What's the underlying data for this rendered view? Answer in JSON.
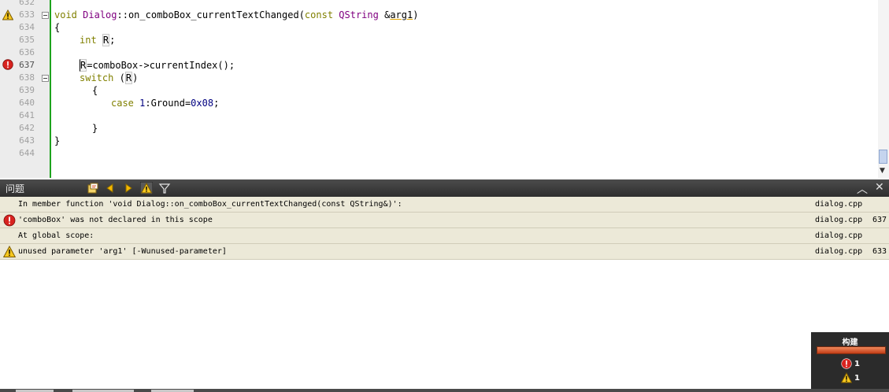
{
  "editor": {
    "lines": [
      {
        "num": "632",
        "text": ""
      },
      {
        "num": "633",
        "text": "void Dialog::on_comboBox_currentTextChanged(const QString &arg1)"
      },
      {
        "num": "634",
        "text": "{"
      },
      {
        "num": "635",
        "text": "int R;"
      },
      {
        "num": "636",
        "text": ""
      },
      {
        "num": "637",
        "text": "R=comboBox->currentIndex();"
      },
      {
        "num": "638",
        "text": "switch (R)"
      },
      {
        "num": "639",
        "text": "{"
      },
      {
        "num": "640",
        "text": "case 1:Ground=0x08;"
      },
      {
        "num": "641",
        "text": ""
      },
      {
        "num": "642",
        "text": "}"
      },
      {
        "num": "643",
        "text": "}"
      },
      {
        "num": "644",
        "text": ""
      }
    ],
    "tokens": {
      "kw_void": "void",
      "cls_dialog": "Dialog",
      "fn_sig": "::on_comboBox_currentTextChanged(",
      "kw_const": "const",
      "cls_qstring": "QString",
      "amp": " &",
      "arg1": "arg1",
      "close_paren": ")",
      "brace_open": "{",
      "kw_int": "int",
      "var_r": "R",
      "semi": ";",
      "stmt_637_rest": "=comboBox->currentIndex();",
      "kw_switch": "switch",
      "paren_open": "(",
      "paren_close": ")",
      "kw_case": "case",
      "num_1": "1",
      "ground_mid": ":Ground=",
      "num_hex": "0x08",
      "brace_close": "}"
    }
  },
  "issues_panel": {
    "title": "问题",
    "rows": [
      {
        "icon": "none",
        "message": "In member function 'void Dialog::on_comboBox_currentTextChanged(const QString&)':",
        "file": "dialog.cpp",
        "line": ""
      },
      {
        "icon": "error-icon",
        "message": "'comboBox' was not declared in this scope",
        "file": "dialog.cpp",
        "line": "637"
      },
      {
        "icon": "none",
        "message": "At global scope:",
        "file": "dialog.cpp",
        "line": ""
      },
      {
        "icon": "warning-icon",
        "message": "unused parameter 'arg1' [-Wunused-parameter]",
        "file": "dialog.cpp",
        "line": "633"
      }
    ]
  },
  "build": {
    "label": "构建",
    "error_count": "1",
    "warning_count": "1"
  },
  "colors": {
    "keyword": "#808000",
    "class": "#800080",
    "number": "#000080",
    "gutter_bar": "#1ea31e",
    "row_bg": "#ece9d8",
    "panel_header": "#3a3a3a",
    "build_bar": "#d9542b"
  }
}
